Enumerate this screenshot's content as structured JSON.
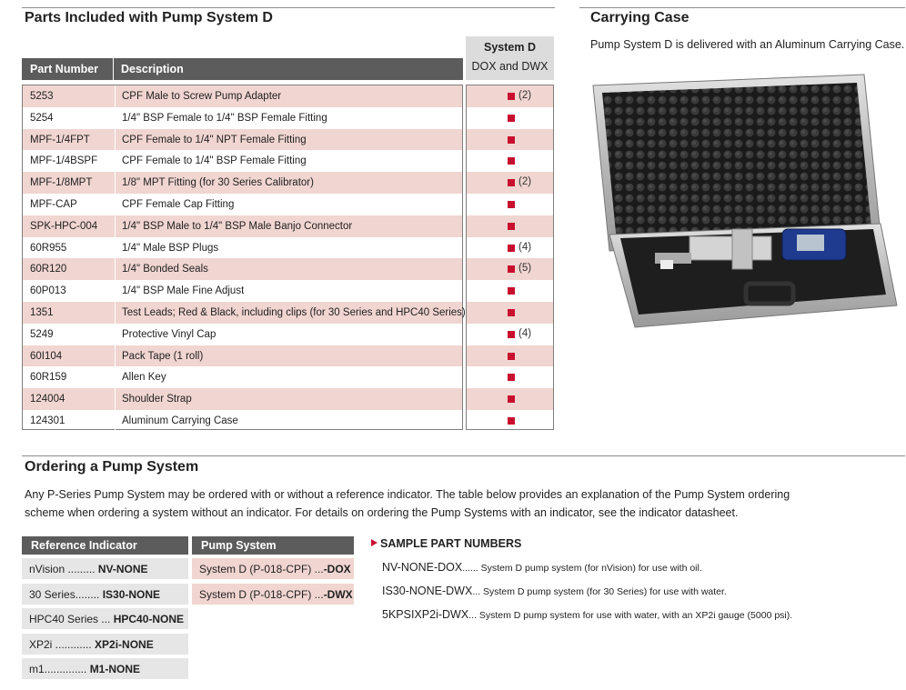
{
  "parts_section": {
    "title": "Parts Included with Pump System D",
    "col_part": "Part Number",
    "col_desc": "Description",
    "sysd_head1": "System D",
    "sysd_head2": "DOX and DWX",
    "rows": [
      {
        "part": "5253",
        "desc": "CPF Male to Screw Pump Adapter",
        "qty": "(2)"
      },
      {
        "part": "5254",
        "desc": "1/4\" BSP Female to 1/4\" BSP Female Fitting",
        "qty": ""
      },
      {
        "part": "MPF-1/4FPT",
        "desc": "CPF Female to 1/4\" NPT Female Fitting",
        "qty": ""
      },
      {
        "part": "MPF-1/4BSPF",
        "desc": "CPF Female to 1/4\" BSP Female Fitting",
        "qty": ""
      },
      {
        "part": "MPF-1/8MPT",
        "desc": "1/8\" MPT Fitting (for 30 Series Calibrator)",
        "qty": "(2)"
      },
      {
        "part": "MPF-CAP",
        "desc": "CPF Female Cap Fitting",
        "qty": ""
      },
      {
        "part": "SPK-HPC-004",
        "desc": "1/4\" BSP Male to 1/4\" BSP Male Banjo Connector",
        "qty": ""
      },
      {
        "part": "60R955",
        "desc": "1/4\" Male BSP Plugs",
        "qty": "(4)"
      },
      {
        "part": "60R120",
        "desc": "1/4\" Bonded Seals",
        "qty": "(5)"
      },
      {
        "part": "60P013",
        "desc": "1/4\" BSP Male Fine Adjust",
        "qty": ""
      },
      {
        "part": "1351",
        "desc": "Test Leads; Red & Black, including clips (for 30 Series and HPC40 Series)",
        "qty": ""
      },
      {
        "part": "5249",
        "desc": "Protective Vinyl Cap",
        "qty": "(4)"
      },
      {
        "part": "60I104",
        "desc": "Pack Tape (1 roll)",
        "qty": ""
      },
      {
        "part": "60R159",
        "desc": "Allen Key",
        "qty": ""
      },
      {
        "part": "124004",
        "desc": "Shoulder Strap",
        "qty": ""
      },
      {
        "part": "124301",
        "desc": "Aluminum Carrying Case",
        "qty": ""
      }
    ]
  },
  "case_section": {
    "title": "Carrying Case",
    "description": "Pump System D is delivered with an Aluminum Carrying Case."
  },
  "ordering": {
    "title": "Ordering a Pump System",
    "para_line1": "Any P-Series Pump System may be ordered with or without a reference indicator. The table below provides an explanation of the Pump System ordering",
    "para_line2": "scheme when ordering a system without an indicator. For details on ordering the Pump Systems with an indicator, see the indicator datasheet.",
    "ref_head": "Reference Indicator",
    "ref_items": [
      {
        "label": "nVision .........",
        "code": "NV-NONE"
      },
      {
        "label": "30 Series........",
        "code": "IS30-NONE"
      },
      {
        "label": "HPC40 Series ...",
        "code": "HPC40-NONE"
      },
      {
        "label": "XP2i ............",
        "code": "XP2i-NONE"
      },
      {
        "label": "m1..............",
        "code": "M1-NONE"
      }
    ],
    "pump_head": "Pump System",
    "pump_items": [
      {
        "label": "System D (P-018-CPF) ...",
        "code": "-DOX"
      },
      {
        "label": "System D (P-018-CPF) ...",
        "code": "-DWX"
      }
    ],
    "sample_title": "SAMPLE PART NUMBERS",
    "samples": [
      {
        "code": "NV-NONE-DOX",
        "dots": "......",
        "desc": "System D pump system (for nVision) for use with oil."
      },
      {
        "code": "IS30-NONE-DWX",
        "dots": "...",
        "desc": "System D pump system (for 30 Series) for use with water."
      },
      {
        "code": "5KPSIXP2i-DWX",
        "dots": "...",
        "desc": "System D pump system for use with water, with an XP2i gauge (5000 psi)."
      }
    ]
  },
  "colors": {
    "accent_red": "#c8102e",
    "row_pink": "#f0d5d0",
    "header_gray": "#5c5c5c"
  }
}
